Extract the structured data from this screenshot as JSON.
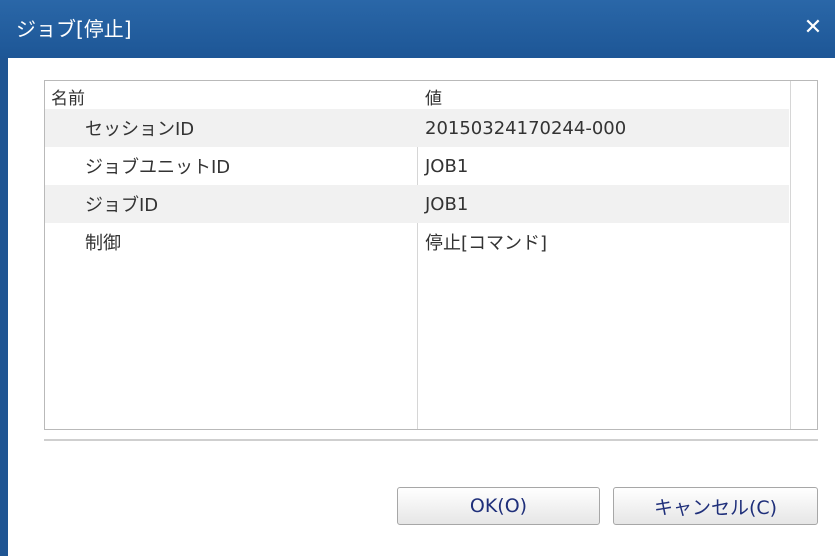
{
  "window": {
    "title": "ジョブ[停止]",
    "close_glyph": "✕"
  },
  "table": {
    "columns": [
      "名前",
      "値"
    ],
    "rows": [
      {
        "name": "セッションID",
        "value": "20150324170244-000"
      },
      {
        "name": "ジョブユニットID",
        "value": "JOB1"
      },
      {
        "name": "ジョブID",
        "value": "JOB1"
      },
      {
        "name": "制御",
        "value": "停止[コマンド]"
      }
    ]
  },
  "buttons": {
    "ok_label": "OK(O)",
    "cancel_label": "キャンセル(C)"
  },
  "colors": {
    "titlebar": "#1d5696",
    "row_alt": "#f1f1f1",
    "button_text": "#1f2f7a"
  },
  "icons": {
    "close": "close-icon"
  }
}
